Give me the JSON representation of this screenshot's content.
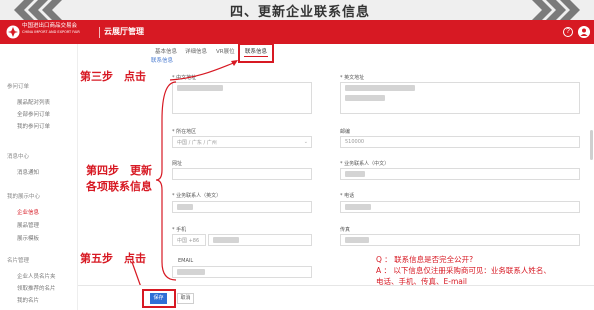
{
  "banner": {
    "heading": "四、更新企业联系信息"
  },
  "appbar": {
    "logo_cn": "中国进出口商品交易会",
    "logo_en": "CHINA IMPORT AND EXPORT FAIR",
    "title": "云展厅管理",
    "help_glyph": "?"
  },
  "sidebar": {
    "groups": [
      {
        "label": "参问订单",
        "items": [
          "展品配对列表",
          "全部参问订单",
          "我的参问订单"
        ]
      },
      {
        "label": "消息中心",
        "items": [
          "消息通知"
        ]
      },
      {
        "label": "我的展示中心",
        "items": [
          "企业信息",
          "展品管理",
          "展示模板"
        ]
      },
      {
        "label": "名片管理",
        "items": [
          "企业人员名片夹",
          "领取推荐的名片",
          "我的名片"
        ]
      }
    ],
    "active_item": "企业信息"
  },
  "tabs": [
    "基本信息",
    "详细信息",
    "VR展位",
    "联系信息"
  ],
  "active_tab": "联系信息",
  "breadcrumb": "联系信息",
  "form": {
    "cn_address_label": "* 中文地址",
    "en_address_label": "* 英文地址",
    "region_label": "* 所在地区",
    "region_value": "中国 / 广东 / 广州",
    "postcode_label": "邮编",
    "postcode_value": "510000",
    "website_label": "网址",
    "contact_cn_label": "* 业务联系人（中文）",
    "contact_en_label": "* 业务联系人（英文）",
    "phone_label": "* 电话",
    "mobile_label": "* 手机",
    "mobile_code": "中国 +86",
    "fax_label": "传真",
    "email_label": "EMAIL"
  },
  "callouts": {
    "step3": "第三步　点击",
    "step4_line1": "第四步　更新",
    "step4_line2": "各项联系信息",
    "step5": "第五步　点击"
  },
  "qa": {
    "q": "Q ：  联系信息是否完全公开?",
    "a_line1": "A ：  以下信息仅注册采购商可见：业务联系人姓名、",
    "a_line2": "电话、手机、传真、E-mail"
  },
  "buttons": {
    "save": "保存",
    "cancel": "取消"
  },
  "colors": {
    "brand_red": "#d71923",
    "primary_blue": "#2f6fd6",
    "link_blue": "#4a7bd0"
  }
}
